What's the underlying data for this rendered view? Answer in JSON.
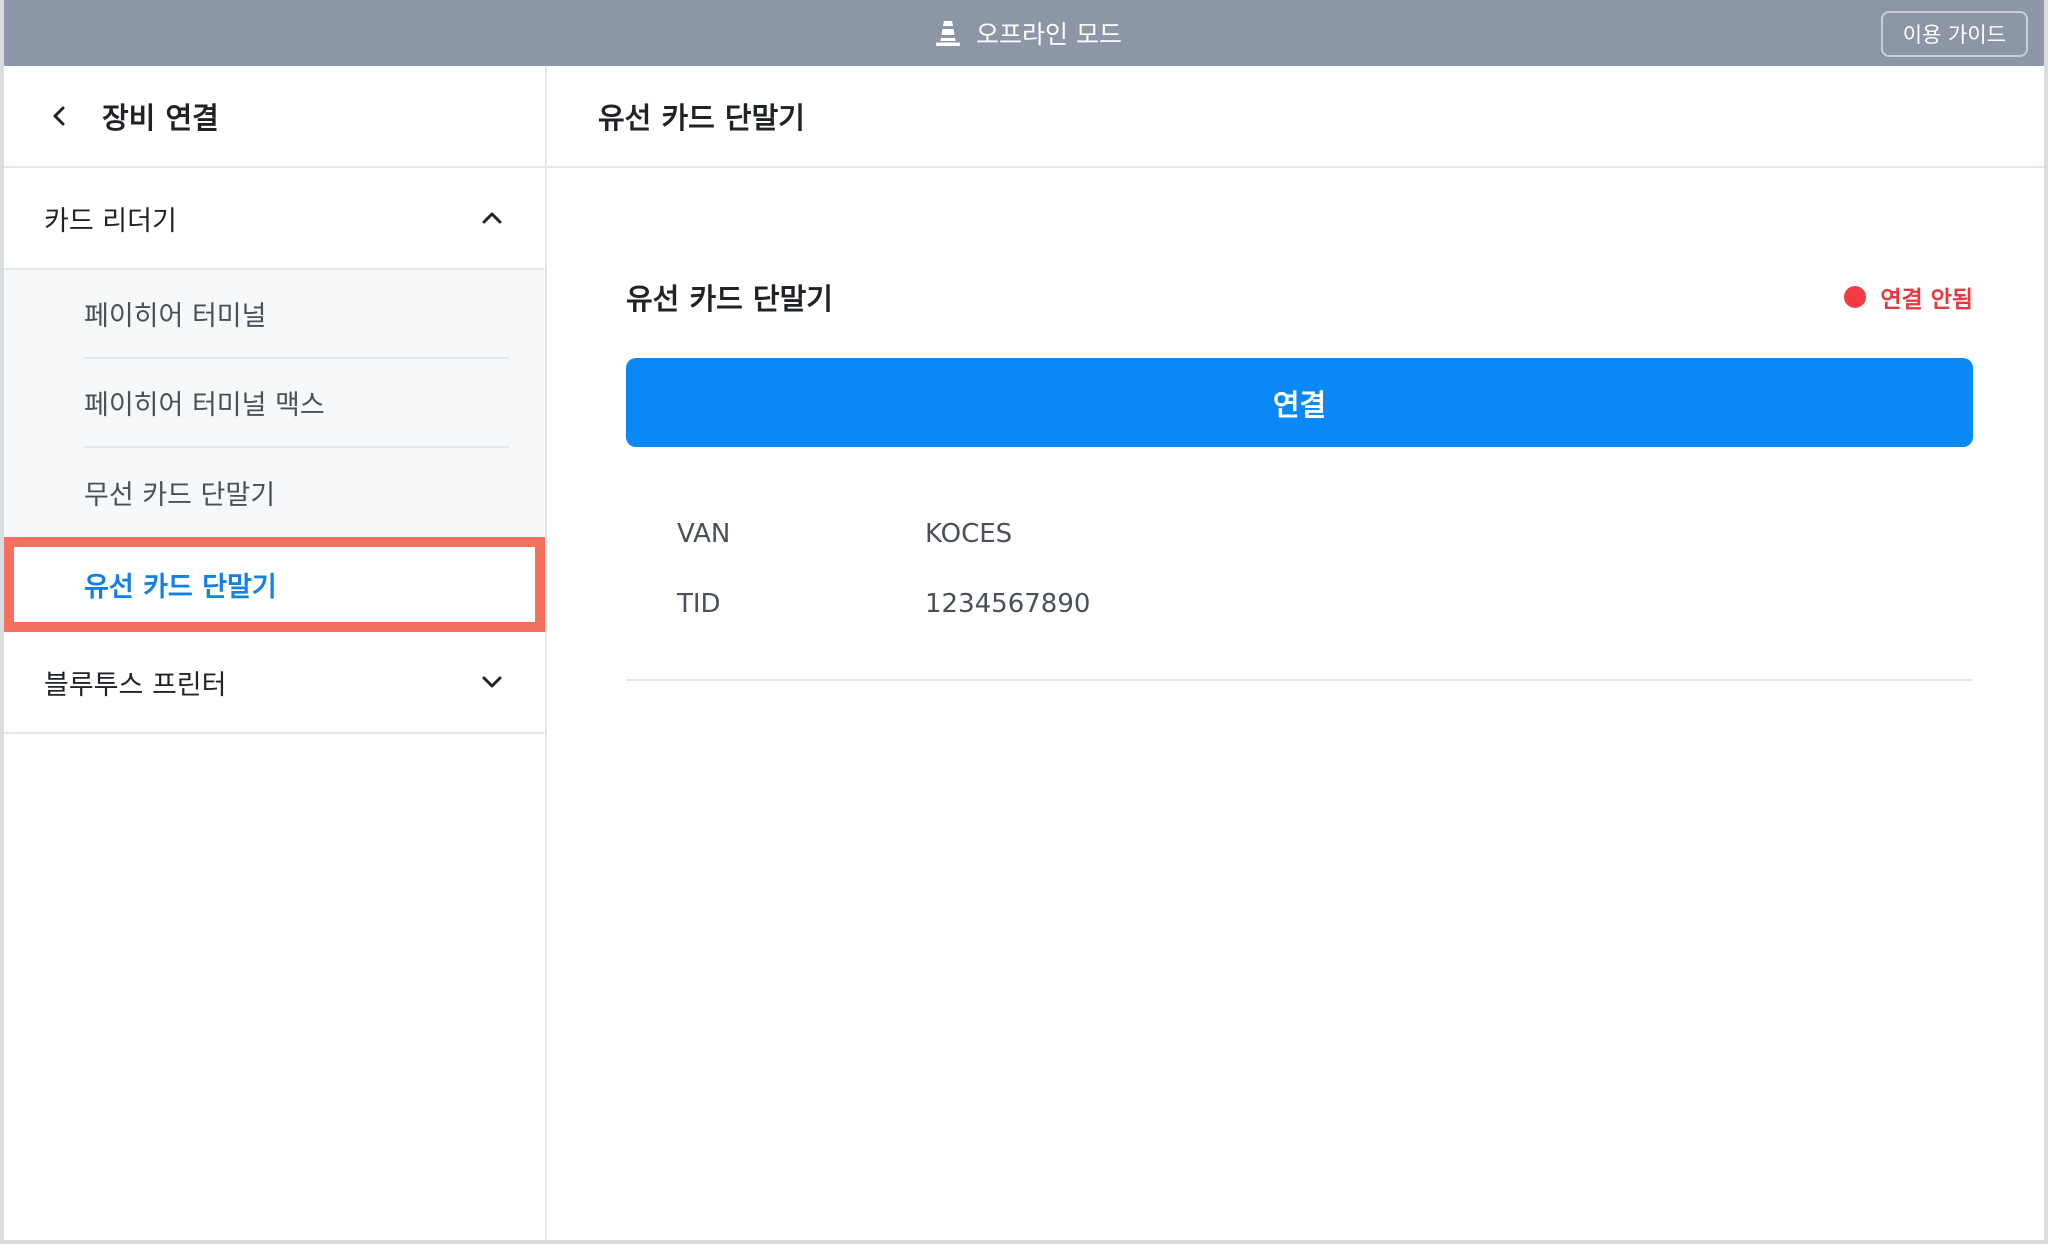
{
  "topbar": {
    "mode_label": "오프라인 모드",
    "guide_label": "이용 가이드"
  },
  "sidebar": {
    "title": "장비 연결",
    "sections": [
      {
        "label": "카드 리더기",
        "expanded": true,
        "items": [
          {
            "label": "페이히어 터미널"
          },
          {
            "label": "페이히어 터미널 맥스"
          },
          {
            "label": "무선 카드 단말기"
          },
          {
            "label": "유선 카드 단말기",
            "selected": true
          }
        ]
      },
      {
        "label": "블루투스 프린터",
        "expanded": false
      }
    ]
  },
  "main": {
    "header_title": "유선 카드 단말기",
    "device": {
      "title": "유선 카드 단말기",
      "status": "연결 안됨",
      "connect_label": "연결",
      "info": [
        {
          "label": "VAN",
          "value": "KOCES"
        },
        {
          "label": "TID",
          "value": "1234567890"
        }
      ]
    }
  },
  "colors": {
    "topbar_bg": "#8c96a6",
    "accent": "#0a88f6",
    "selected_text": "#1280e6",
    "status_red": "#e8393f",
    "highlight_border": "#f4705c"
  }
}
